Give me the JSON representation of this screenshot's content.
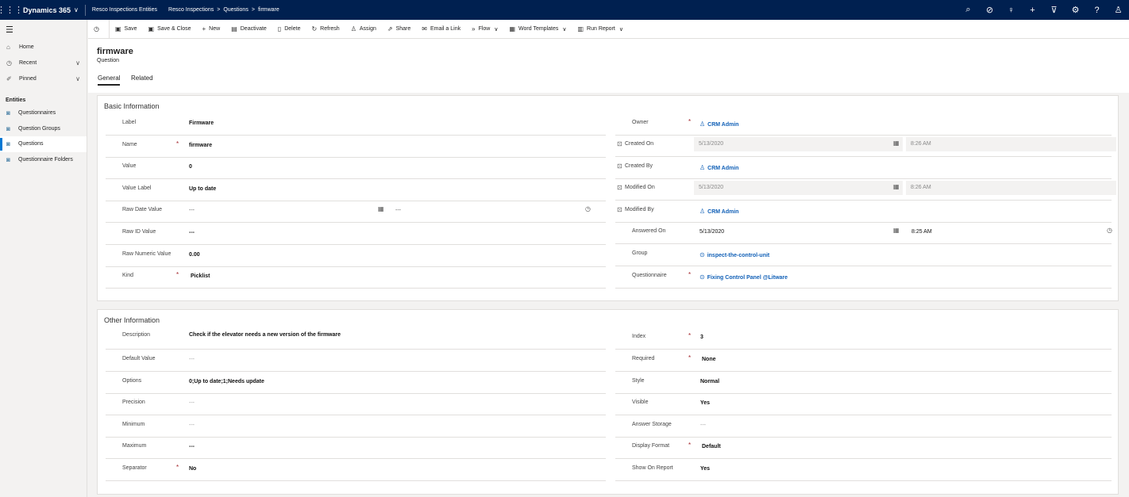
{
  "topbar": {
    "app_name": "Dynamics 365",
    "entity_name": "Resco Inspections Entities",
    "breadcrumb": [
      "Resco Inspections",
      "Questions",
      "firmware"
    ]
  },
  "sidebar": {
    "nav": [
      {
        "label": "Home"
      },
      {
        "label": "Recent"
      },
      {
        "label": "Pinned"
      }
    ],
    "entities_header": "Entities",
    "entities": [
      {
        "label": "Questionnaires"
      },
      {
        "label": "Question Groups"
      },
      {
        "label": "Questions"
      },
      {
        "label": "Questionnaire Folders"
      }
    ]
  },
  "commands": {
    "save": "Save",
    "save_close": "Save & Close",
    "new": "New",
    "deactivate": "Deactivate",
    "delete": "Delete",
    "refresh": "Refresh",
    "assign": "Assign",
    "share": "Share",
    "email_link": "Email a Link",
    "flow": "Flow",
    "word_templates": "Word Templates",
    "run_report": "Run Report"
  },
  "record": {
    "title": "firmware",
    "type": "Question",
    "tabs": [
      "General",
      "Related"
    ]
  },
  "basic": {
    "title": "Basic Information",
    "left": [
      {
        "label": "Label",
        "value": "Firmware",
        "required": false
      },
      {
        "label": "Name",
        "value": "firmware",
        "required": true
      },
      {
        "label": "Value",
        "value": "0",
        "required": false
      },
      {
        "label": "Value Label",
        "value": "Up to date",
        "required": false
      },
      {
        "label": "Raw Date Value",
        "value": "---",
        "time": "---",
        "required": false
      },
      {
        "label": "Raw ID Value",
        "value": "---",
        "required": false
      },
      {
        "label": "Raw Numeric Value",
        "value": "0.00",
        "required": false
      },
      {
        "label": "Kind",
        "value": "Picklist",
        "required": true
      }
    ],
    "right": {
      "owner": {
        "label": "Owner",
        "value": "CRM Admin"
      },
      "created_on": {
        "label": "Created On",
        "date": "5/13/2020",
        "time": "8:26 AM"
      },
      "created_by": {
        "label": "Created By",
        "value": "CRM Admin"
      },
      "modified_on": {
        "label": "Modified On",
        "date": "5/13/2020",
        "time": "8:26 AM"
      },
      "modified_by": {
        "label": "Modified By",
        "value": "CRM Admin"
      },
      "answered_on": {
        "label": "Answered On",
        "date": "5/13/2020",
        "time": "8:25 AM"
      },
      "group": {
        "label": "Group",
        "value": "inspect-the-control-unit"
      },
      "questionnaire": {
        "label": "Questionnaire",
        "value": "Fixing Control Panel @Litware"
      }
    }
  },
  "other": {
    "title": "Other Information",
    "left": [
      {
        "label": "Description",
        "value": "Check if the elevator needs a new version of the firmware",
        "required": false
      },
      {
        "label": "Default Value",
        "value": "---",
        "required": false
      },
      {
        "label": "Options",
        "value": "0;Up to date;1;Needs update",
        "required": false
      },
      {
        "label": "Precision",
        "value": "---",
        "required": false
      },
      {
        "label": "Minimum",
        "value": "---",
        "required": false
      },
      {
        "label": "Maximum",
        "value": "---",
        "required": false
      },
      {
        "label": "Separator",
        "value": "No",
        "required": true
      }
    ],
    "right": [
      {
        "label": "Index",
        "value": "3",
        "required": true
      },
      {
        "label": "Required",
        "value": "None",
        "required": true
      },
      {
        "label": "Style",
        "value": "Normal",
        "required": false
      },
      {
        "label": "Visible",
        "value": "Yes",
        "required": false
      },
      {
        "label": "Answer Storage",
        "value": "---",
        "required": false
      },
      {
        "label": "Display Format",
        "value": "Default",
        "required": true
      },
      {
        "label": "Show On Report",
        "value": "Yes",
        "required": false
      }
    ]
  }
}
